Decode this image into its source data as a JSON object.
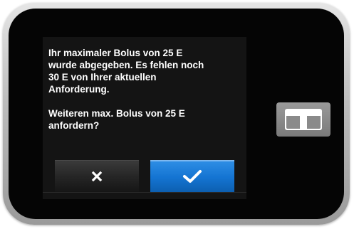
{
  "dialog": {
    "message": "Ihr maximaler Bolus von 25 E\nwurde abgegeben. Es fehlen noch\n30 E von Ihrer aktuellen\nAnforderung.",
    "question": "Weiteren max. Bolus von 25 E\nanfordern?"
  },
  "buttons": {
    "cancel_icon": "close-icon",
    "confirm_icon": "checkmark-icon"
  },
  "colors": {
    "accent": "#1474d2",
    "screen_bg": "#141414",
    "text": "#ffffff",
    "logo": "#8a8a8a"
  },
  "device": {
    "logo_icon": "t-logo-icon"
  }
}
